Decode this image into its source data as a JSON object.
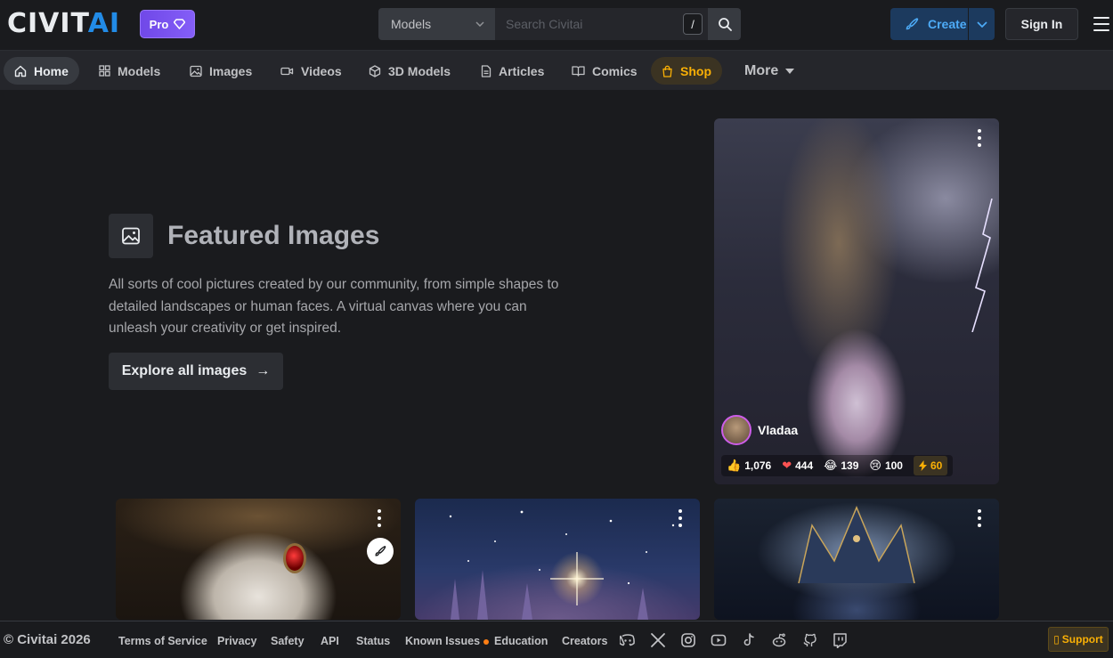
{
  "header": {
    "logo_main": "CIVIT",
    "logo_accent": "AI",
    "pro_label": "Pro",
    "search_scope": "Models",
    "search_placeholder": "Search Civitai",
    "search_shortcut": "/",
    "create_label": "Create",
    "signin_label": "Sign In"
  },
  "nav": {
    "items": [
      {
        "label": "Home",
        "icon": "home-icon"
      },
      {
        "label": "Models",
        "icon": "grid-icon"
      },
      {
        "label": "Images",
        "icon": "photo-icon"
      },
      {
        "label": "Videos",
        "icon": "video-icon"
      },
      {
        "label": "3D Models",
        "icon": "cube-icon"
      },
      {
        "label": "Articles",
        "icon": "file-text-icon"
      },
      {
        "label": "Comics",
        "icon": "book-icon"
      },
      {
        "label": "Shop",
        "icon": "shopping-bag-icon"
      },
      {
        "label": "More",
        "icon": "caret-down-icon"
      }
    ]
  },
  "hero": {
    "title": "Featured Images",
    "description": "All sorts of cool pictures created by our community, from simple shapes to detailed landscapes or human faces. A virtual canvas where you can unleash your creativity or get inspired.",
    "cta_label": "Explore all images",
    "cta_arrow": "→"
  },
  "featured_card": {
    "username": "Vladaa",
    "reactions": {
      "like": "1,076",
      "heart": "444",
      "laugh": "139",
      "cry": "100",
      "buzz": "60"
    }
  },
  "footer": {
    "copyright": "© Civitai 2026",
    "links": [
      "Terms of Service",
      "Privacy",
      "Safety",
      "API",
      "Status",
      "Known Issues",
      "Education",
      "Creators"
    ],
    "support_label": "Support",
    "support_icon": "lifebuoy-icon"
  },
  "colors": {
    "background": "#1a1b1e",
    "nav_background": "#25262b",
    "accent_blue": "#228be6",
    "pro_purple": "#7048e8",
    "shop_yellow": "#fab005"
  }
}
